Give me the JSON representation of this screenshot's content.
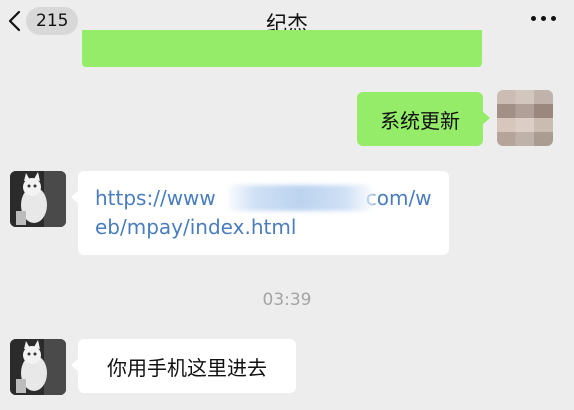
{
  "header": {
    "back_count": "215",
    "title": "纪杰",
    "more_icon": "more-dots-icon",
    "back_icon": "chevron-left-icon"
  },
  "messages": [
    {
      "side": "out",
      "text": "系统更新"
    },
    {
      "side": "in",
      "type": "link",
      "text": "https://www.█████████.com/web/mpay/index.html",
      "text_prefix": "https://www",
      "text_suffix": "com/web/mpay/index.html"
    },
    {
      "type": "time",
      "text": "03:39"
    },
    {
      "side": "in",
      "text": "你用手机这里进去"
    }
  ],
  "colors": {
    "background": "#ededed",
    "outgoing_bubble": "#95ec69",
    "incoming_bubble": "#ffffff",
    "link": "#4a7dbf"
  }
}
